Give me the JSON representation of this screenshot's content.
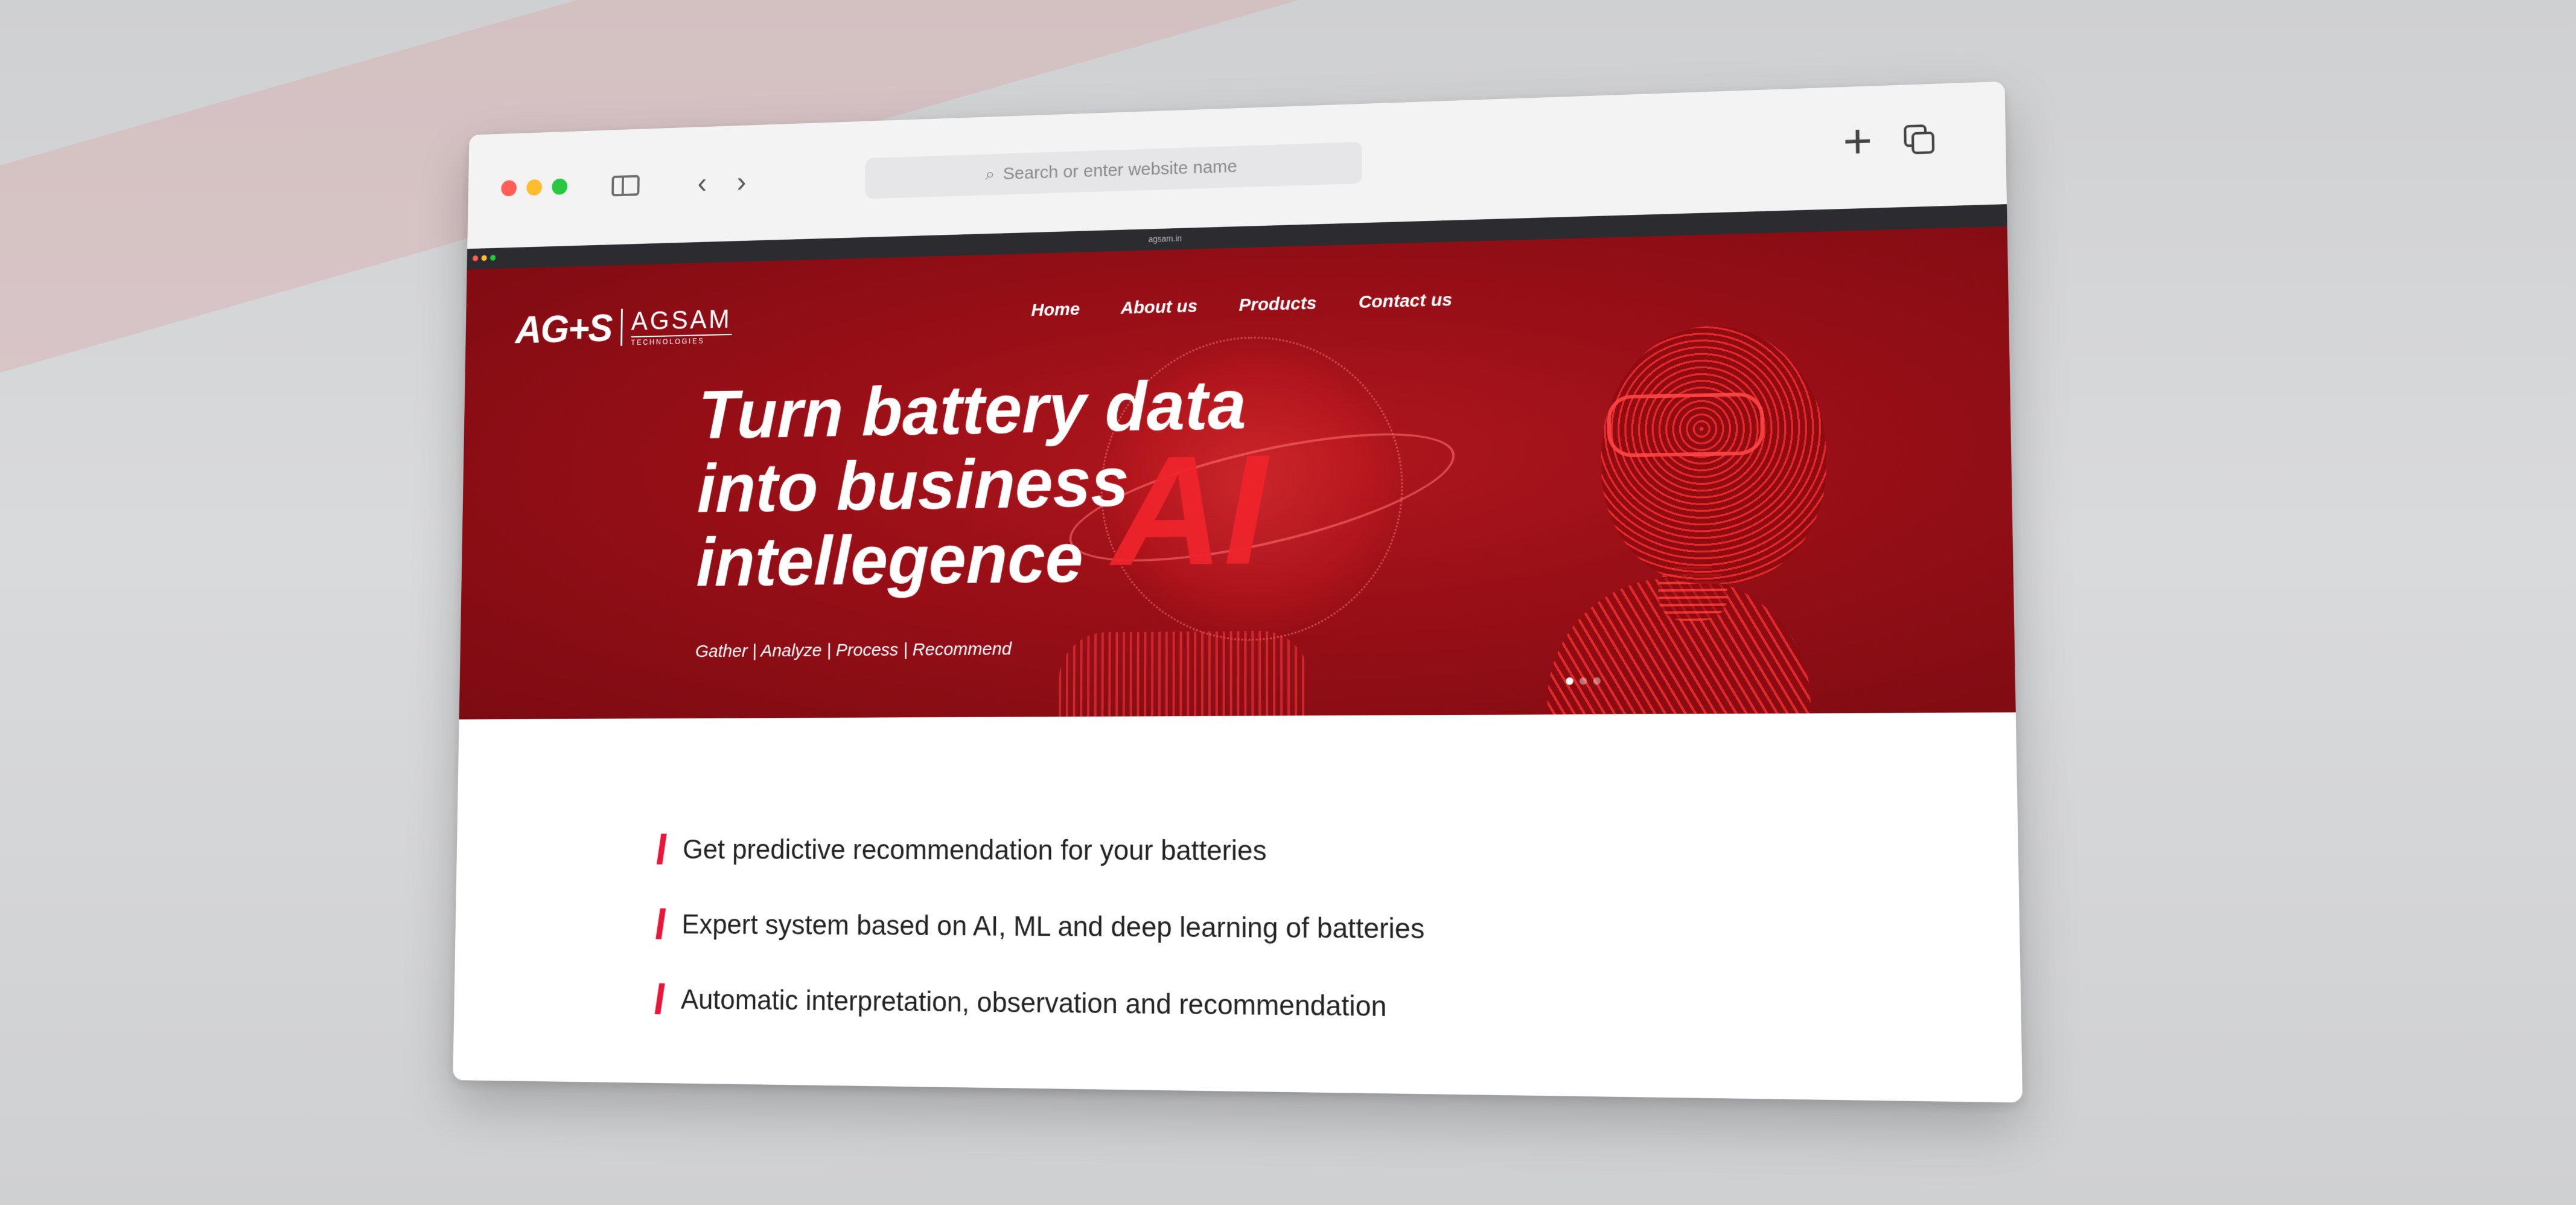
{
  "browser": {
    "address_placeholder": "Search or enter website name",
    "inner_url": "agsam.in"
  },
  "site": {
    "logo_mark": "AG+S",
    "logo_name": "AGSAM",
    "logo_sub": "TECHNOLOGIES",
    "nav": [
      "Home",
      "About us",
      "Products",
      "Contact us"
    ]
  },
  "hero": {
    "title_lines": [
      "Turn battery data",
      "into business",
      "intellegence"
    ],
    "tagline": "Gather |  Analyze |  Process |  Recommend",
    "overlay_text": "AI",
    "slide_index": 1,
    "slide_count": 3
  },
  "features": [
    "Get predictive recommendation for your batteries",
    "Expert system based on AI, ML and deep learning of batteries",
    "Automatic interpretation, observation and recommendation"
  ],
  "colors": {
    "brand_red": "#9a0f17",
    "accent_red": "#e8173a",
    "ai_red": "#f0242b"
  }
}
